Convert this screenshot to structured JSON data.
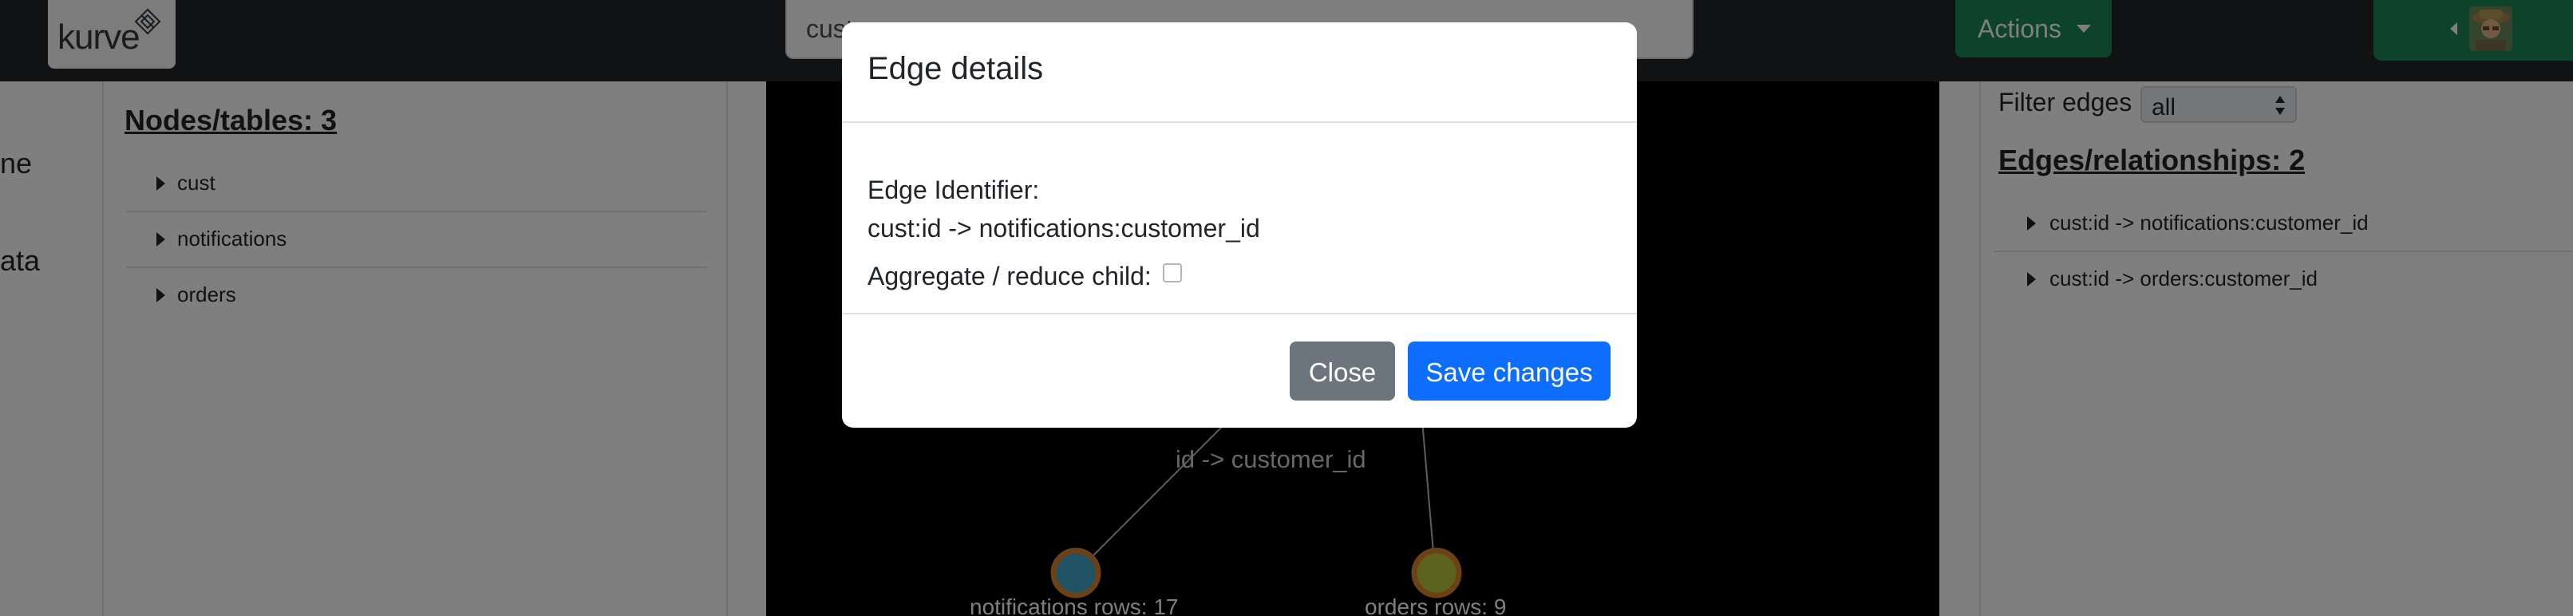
{
  "header": {
    "logo_text": "kurve",
    "search_value": "cust",
    "actions_label": "Actions"
  },
  "left_rail": {
    "items": [
      "ne",
      "ata"
    ]
  },
  "nodes_panel": {
    "title": "Nodes/tables: 3",
    "items": [
      {
        "label": "cust"
      },
      {
        "label": "notifications"
      },
      {
        "label": "orders"
      }
    ]
  },
  "graph": {
    "edge_label": "id -> customer_id",
    "nodes": [
      {
        "label": "notifications rows: 17",
        "fill": "#3fa6c6",
        "ring": "#d9822b"
      },
      {
        "label": "orders rows: 9",
        "fill": "#b9c63c",
        "ring": "#d9822b"
      }
    ]
  },
  "edges_panel": {
    "filter_label": "Filter edges",
    "filter_value": "all",
    "title": "Edges/relationships: 2",
    "items": [
      {
        "label": "cust:id -> notifications:customer_id"
      },
      {
        "label": "cust:id -> orders:customer_id"
      }
    ]
  },
  "modal": {
    "title": "Edge details",
    "identifier_label": "Edge Identifier:",
    "identifier_value": "cust:id -> notifications:customer_id",
    "aggregate_label": "Aggregate / reduce child:",
    "aggregate_checked": false,
    "close_label": "Close",
    "save_label": "Save changes"
  },
  "colors": {
    "navbar": "#212529",
    "success": "#198754",
    "primary": "#0d6efd",
    "secondary": "#6c757d"
  }
}
